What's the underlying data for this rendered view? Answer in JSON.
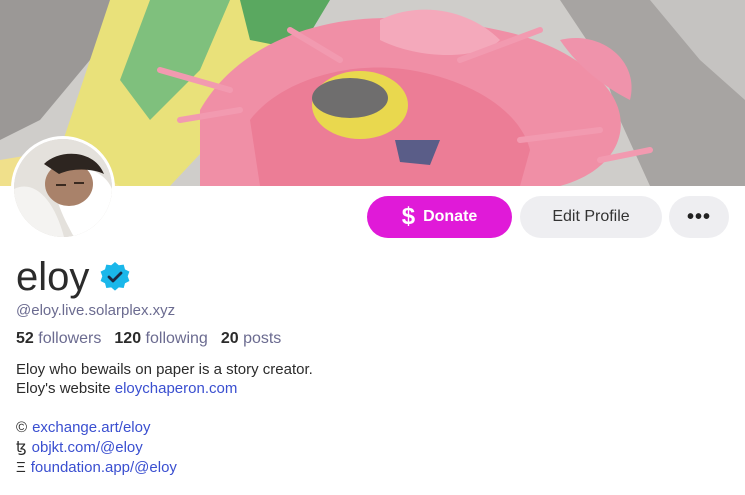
{
  "profile": {
    "display_name": "eloy",
    "handle": "@eloy.live.solarplex.xyz",
    "verified": true
  },
  "actions": {
    "donate_icon": "$",
    "donate_label": "Donate",
    "edit_label": "Edit Profile",
    "more_label": "•••"
  },
  "stats": {
    "followers_count": "52",
    "followers_label": "followers",
    "following_count": "120",
    "following_label": "following",
    "posts_count": "20",
    "posts_label": "posts"
  },
  "bio": {
    "line1": "Eloy who bewails on paper is a story creator.",
    "line2_prefix": "Eloy's website ",
    "line2_link": "eloychaperon.com"
  },
  "links": [
    {
      "glyph": "©",
      "url": "exchange.art/eloy"
    },
    {
      "glyph": "ꜩ",
      "url": "objkt.com/@eloy"
    },
    {
      "glyph": "Ξ",
      "url": "foundation.app/@eloy"
    }
  ],
  "colors": {
    "accent_donate": "#e01ad8",
    "verified_badge": "#1da1f2",
    "link": "#3a4fd0",
    "muted": "#6b6b90"
  }
}
